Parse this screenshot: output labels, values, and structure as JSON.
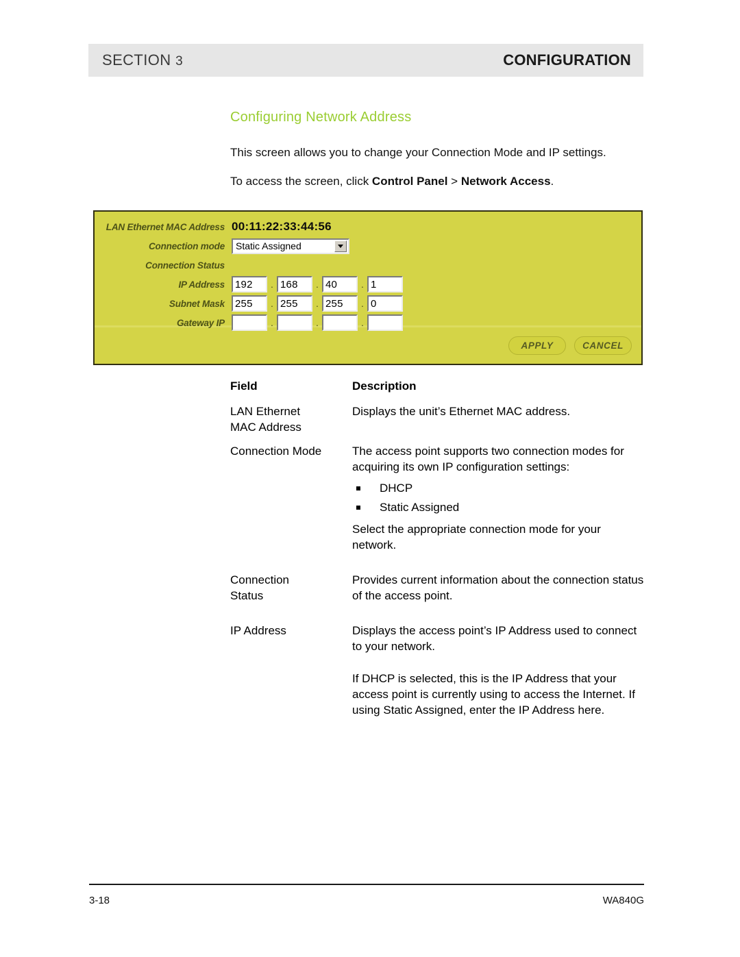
{
  "header": {
    "section_label": "SECTION",
    "section_number": "3",
    "right_title": "CONFIGURATION"
  },
  "content": {
    "title": "Configuring Network Address",
    "intro_1": "This screen allows you to change your Connection Mode and IP settings.",
    "intro_2_prefix": "To access the screen, click ",
    "intro_2_bold_1": "Control Panel",
    "intro_2_mid": " > ",
    "intro_2_bold_2": "Network Access",
    "intro_2_suffix": "."
  },
  "screenshot": {
    "labels": {
      "mac": "LAN Ethernet MAC Address",
      "connection_mode": "Connection mode",
      "connection_status": "Connection Status",
      "ip_address": "IP Address",
      "subnet_mask": "Subnet Mask",
      "gateway_ip": "Gateway IP"
    },
    "mac_value": "00:11:22:33:44:56",
    "connection_mode_value": "Static Assigned",
    "connection_status_value": "",
    "separator": ".",
    "ip_address_octets": [
      "192",
      "168",
      "40",
      "1"
    ],
    "subnet_mask_octets": [
      "255",
      "255",
      "255",
      "0"
    ],
    "gateway_ip_octets": [
      "",
      "",
      "",
      ""
    ],
    "apply_label": "APPLY",
    "cancel_label": "CANCEL",
    "colors": {
      "panel_background": "#d4d447",
      "panel_border": "#312f12",
      "label_text": "#4d5217",
      "button_fill": "#d2d23f",
      "button_border": "#b4b430",
      "divider": "#dcdc60"
    }
  },
  "table": {
    "head_field": "Field",
    "head_description": "Description",
    "rows": [
      {
        "field": "LAN Ethernet MAC Address",
        "field_line1": "LAN Ethernet",
        "field_line2": "MAC Address",
        "desc_1": "Displays the unit’s Ethernet MAC address."
      },
      {
        "field": "Connection Mode",
        "desc_1": "The access point supports two connection modes for acquiring its own IP configuration settings:",
        "bullets": [
          "DHCP",
          "Static Assigned"
        ],
        "desc_2": "Select the appropriate connection mode for your network."
      },
      {
        "field": "Connection Status",
        "field_line1": "Connection",
        "field_line2": "Status",
        "desc_1": "Provides current information about the connection status of the access point."
      },
      {
        "field": "IP Address",
        "desc_1": "Displays the access point’s IP Address used to connect to your network.",
        "desc_2": "If DHCP is selected, this is the IP Address that your access point is currently using to access the Internet. If using Static Assigned, enter the IP Address here."
      }
    ]
  },
  "footer": {
    "page_number": "3-18",
    "model": "WA840G"
  },
  "theme": {
    "title_green": "#9acd32",
    "header_bar_gray": "#e6e6e6"
  }
}
